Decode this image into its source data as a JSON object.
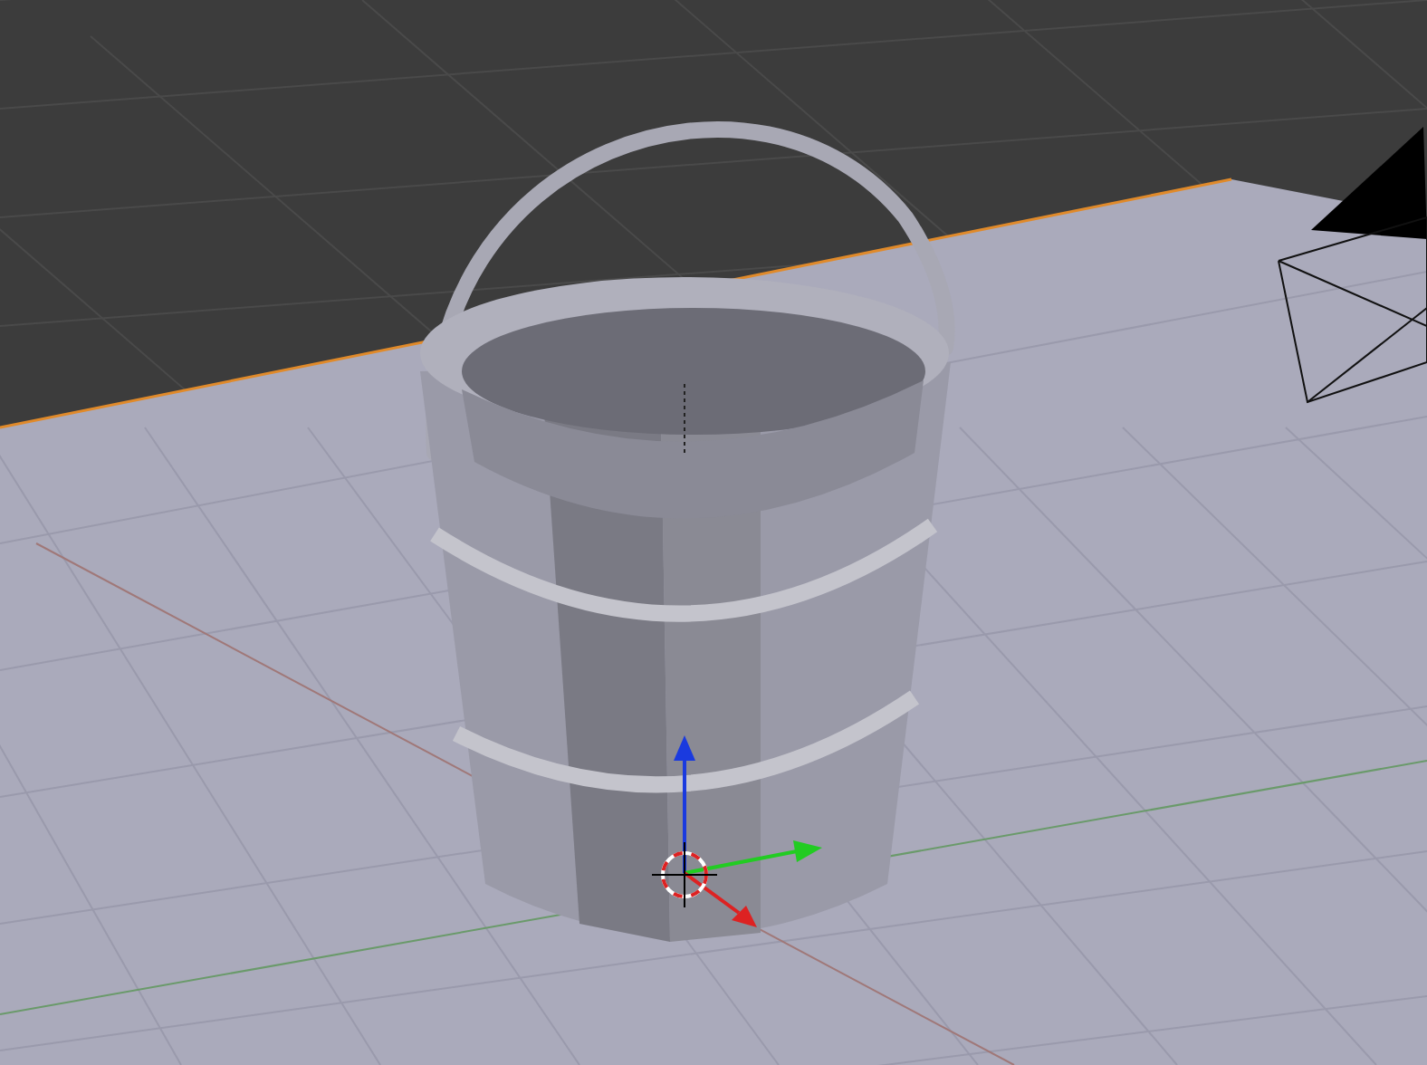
{
  "viewport": {
    "objects": [
      {
        "kind": "grid"
      },
      {
        "kind": "floor"
      },
      {
        "kind": "camera"
      },
      {
        "kind": "bucket"
      },
      {
        "kind": "gizmo"
      },
      {
        "kind": "cursor"
      }
    ]
  }
}
